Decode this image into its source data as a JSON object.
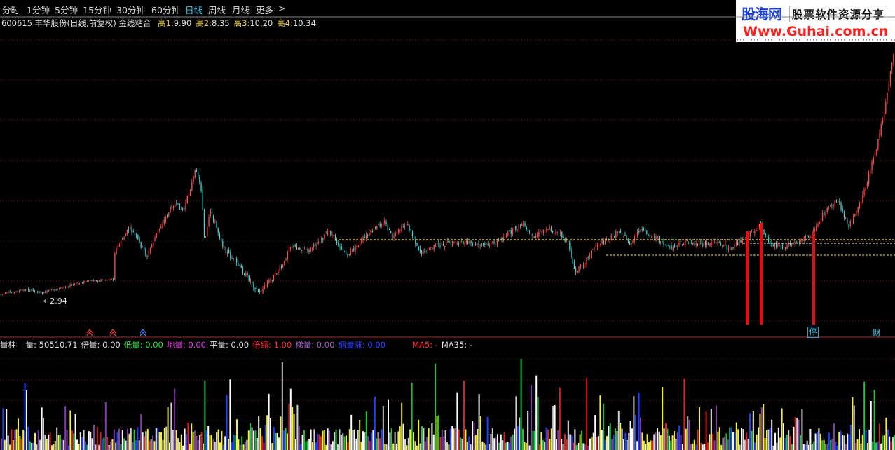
{
  "toolbar": {
    "timeframes": [
      "分时",
      "1分钟",
      "5分钟",
      "15分钟",
      "30分钟",
      "60分钟",
      "日线",
      "周线",
      "月线",
      "更多"
    ],
    "active": "日线",
    "more_arrow": ">"
  },
  "info": {
    "title": "600615 丰华股份(日线,前复权) 金线粘合",
    "items": [
      {
        "label": "高1:",
        "value": "9.90"
      },
      {
        "label": "高2:",
        "value": "8.35"
      },
      {
        "label": "高3:",
        "value": "10.20"
      },
      {
        "label": "高4:",
        "value": "10.34"
      }
    ]
  },
  "logo": {
    "brand": "股海网",
    "tagline": "股票软件资源分享",
    "url": "Www.Guhai.com.cn"
  },
  "chart": {
    "low_label": "2.94",
    "markers": {
      "ting": "停",
      "cai": "财"
    }
  },
  "volume_info": {
    "title": "量柱",
    "items": [
      {
        "label": "量:",
        "value": "50510.71",
        "color": "#e0e0e0"
      },
      {
        "label": "倍量:",
        "value": "0.00",
        "color": "#e0e0e0"
      },
      {
        "label": "低量:",
        "value": "0.00",
        "color": "#30e040"
      },
      {
        "label": "地量:",
        "value": "0.00",
        "color": "#e040e0"
      },
      {
        "label": "平量:",
        "value": "0.00",
        "color": "#e0e0e0"
      },
      {
        "label": "倍缩:",
        "value": "1.00",
        "color": "#ff3030"
      },
      {
        "label": "梯量:",
        "value": "0.00",
        "color": "#a060c0"
      },
      {
        "label": "缩量涨:",
        "value": "0.00",
        "color": "#3040ff"
      },
      {
        "label": "MA5:",
        "value": "-",
        "color": "#ff3030"
      },
      {
        "label": "MA35:",
        "value": "-",
        "color": "#e0e0e0"
      }
    ]
  },
  "colors": {
    "up": "#ff5050",
    "down": "#50d0d0",
    "bg": "#000000",
    "gold_line": "#f0e060",
    "signal": "#e01010",
    "active_tab": "#39c8e8"
  }
}
